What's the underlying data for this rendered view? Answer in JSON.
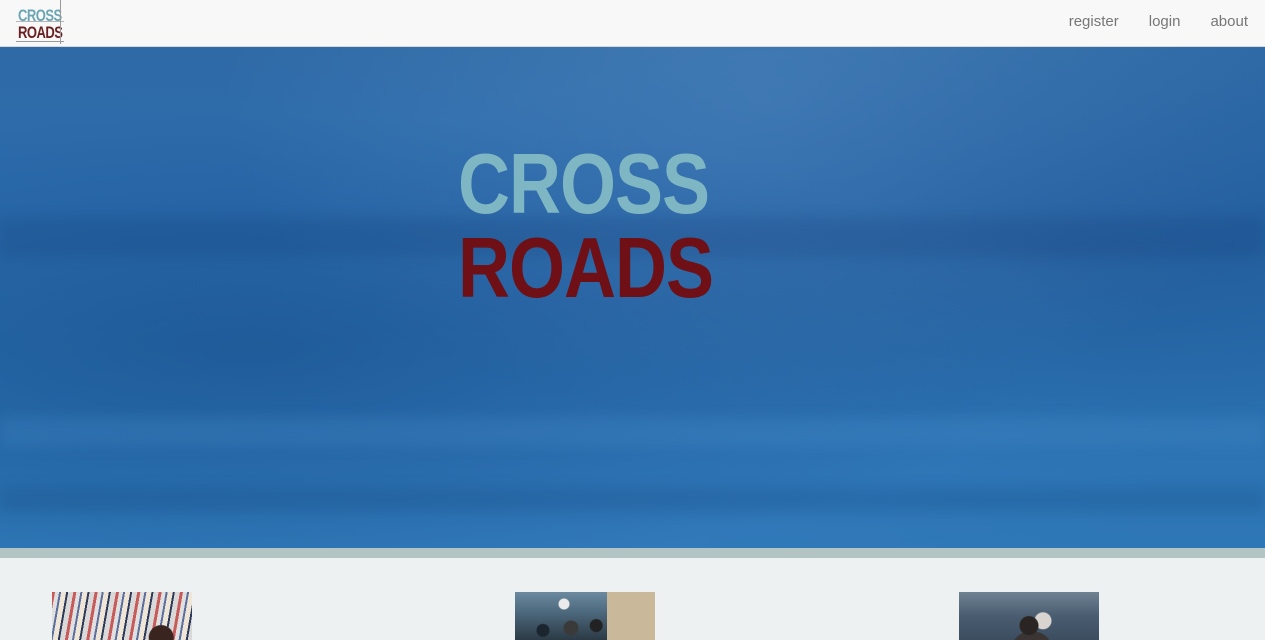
{
  "brand": {
    "line1": "CROSS",
    "line2": "ROADS",
    "colors": {
      "cross": "#6aa5b5",
      "roads": "#6b1f21"
    }
  },
  "nav": {
    "links": [
      {
        "label": "register"
      },
      {
        "label": "login"
      },
      {
        "label": "about"
      }
    ]
  },
  "hero": {
    "line1": "CROSS",
    "line2": "ROADS",
    "colors": {
      "background": "#2b6cae",
      "cross": "#7eb6c3",
      "roads": "#6e1015"
    }
  },
  "articles": [
    {
      "image": "thumbnail-newspapers-woman"
    },
    {
      "image": "thumbnail-crowd-fence"
    },
    {
      "image": "thumbnail-two-people-sea"
    }
  ]
}
